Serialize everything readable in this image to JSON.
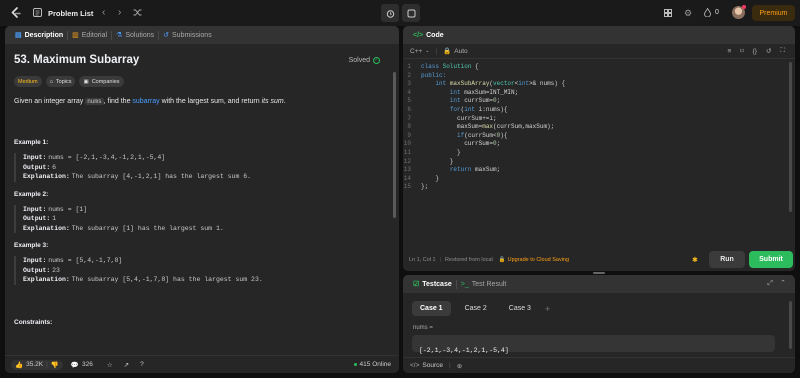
{
  "topbar": {
    "problem_list_label": "Problem List",
    "streak_count": "0",
    "premium_label": "Premium"
  },
  "left": {
    "tabs": [
      "Description",
      "Editorial",
      "Solutions",
      "Submissions"
    ],
    "title": "53. Maximum Subarray",
    "status": "Solved",
    "tags": [
      "Medium",
      "Topics",
      "Companies"
    ],
    "description": {
      "p1": "Given an integer array ",
      "code": "nums",
      "p2": ", find the ",
      "link": "subarray",
      "p3": " with the largest sum, and return ",
      "em": "its sum",
      "p4": "."
    },
    "examples": [
      {
        "title": "Example 1:",
        "input": "nums = [-2,1,-3,4,-1,2,1,-5,4]",
        "output": "6",
        "explanation": "The subarray [4,-1,2,1] has the largest sum 6."
      },
      {
        "title": "Example 2:",
        "input": "nums = [1]",
        "output": "1",
        "explanation": "The subarray [1] has the largest sum 1."
      },
      {
        "title": "Example 3:",
        "input": "nums = [5,4,-1,7,8]",
        "output": "23",
        "explanation": "The subarray [5,4,-1,7,8] has the largest sum 23."
      }
    ],
    "labels": {
      "input": "Input:",
      "output": "Output:",
      "explanation": "Explanation:"
    },
    "constraints_title": "Constraints:",
    "footer": {
      "likes": "35.2K",
      "comments": "326",
      "online": "415 Online"
    }
  },
  "code": {
    "tab_label": "Code",
    "language": "C++",
    "mode": "Auto",
    "lines": [
      [
        {
          "t": "class ",
          "c": "kw"
        },
        {
          "t": "Solution ",
          "c": "ty"
        },
        {
          "t": "{",
          "c": "tx"
        }
      ],
      [
        {
          "t": "public:",
          "c": "kw"
        }
      ],
      [
        {
          "t": "    ",
          "c": "tx"
        },
        {
          "t": "int ",
          "c": "kw"
        },
        {
          "t": "maxSubArray",
          "c": "fn"
        },
        {
          "t": "(",
          "c": "tx"
        },
        {
          "t": "vector",
          "c": "ty"
        },
        {
          "t": "<",
          "c": "tx"
        },
        {
          "t": "int",
          "c": "kw"
        },
        {
          "t": ">& nums) {",
          "c": "tx"
        }
      ],
      [
        {
          "t": "        ",
          "c": "tx"
        },
        {
          "t": "int ",
          "c": "kw"
        },
        {
          "t": "maxSum=INT_MIN;",
          "c": "tx"
        }
      ],
      [
        {
          "t": "        ",
          "c": "tx"
        },
        {
          "t": "int ",
          "c": "kw"
        },
        {
          "t": "currSum=",
          "c": "tx"
        },
        {
          "t": "0",
          "c": "nm"
        },
        {
          "t": ";",
          "c": "tx"
        }
      ],
      [
        {
          "t": "        ",
          "c": "tx"
        },
        {
          "t": "for",
          "c": "kw"
        },
        {
          "t": "(",
          "c": "tx"
        },
        {
          "t": "int ",
          "c": "kw"
        },
        {
          "t": "i:nums){",
          "c": "tx"
        }
      ],
      [
        {
          "t": "          currSum+=i;",
          "c": "tx"
        }
      ],
      [
        {
          "t": "          maxSum=",
          "c": "tx"
        },
        {
          "t": "max",
          "c": "fn"
        },
        {
          "t": "(currSum,maxSum);",
          "c": "tx"
        }
      ],
      [
        {
          "t": "          ",
          "c": "tx"
        },
        {
          "t": "if",
          "c": "kw"
        },
        {
          "t": "(currSum<",
          "c": "tx"
        },
        {
          "t": "0",
          "c": "nm"
        },
        {
          "t": "){",
          "c": "tx"
        }
      ],
      [
        {
          "t": "            currSum=",
          "c": "tx"
        },
        {
          "t": "0",
          "c": "nm"
        },
        {
          "t": ";",
          "c": "tx"
        }
      ],
      [
        {
          "t": "          }",
          "c": "tx"
        }
      ],
      [
        {
          "t": "        }",
          "c": "tx"
        }
      ],
      [
        {
          "t": "        ",
          "c": "tx"
        },
        {
          "t": "return ",
          "c": "kw"
        },
        {
          "t": "maxSum;",
          "c": "tx"
        }
      ],
      [
        {
          "t": "    }",
          "c": "tx"
        }
      ],
      [
        {
          "t": "};",
          "c": "tx"
        }
      ]
    ],
    "status": {
      "position": "Ln 1, Col 1",
      "restored": "Restored from local",
      "upgrade": "Upgrade to Cloud Saving"
    },
    "run_label": "Run",
    "submit_label": "Submit"
  },
  "testcase": {
    "tab_label": "Testcase",
    "result_label": "Test Result",
    "cases": [
      "Case 1",
      "Case 2",
      "Case 3"
    ],
    "field_label": "nums =",
    "field_value": "[-2,1,-3,4,-1,2,1,-5,4]",
    "source_label": "Source"
  },
  "colors": {
    "accent_orange": "#ffa116",
    "easy_green": "#2cbb5d",
    "medium": "#ffc01e",
    "link_blue": "#4a9eff",
    "submit_green": "#2cbb5d"
  }
}
